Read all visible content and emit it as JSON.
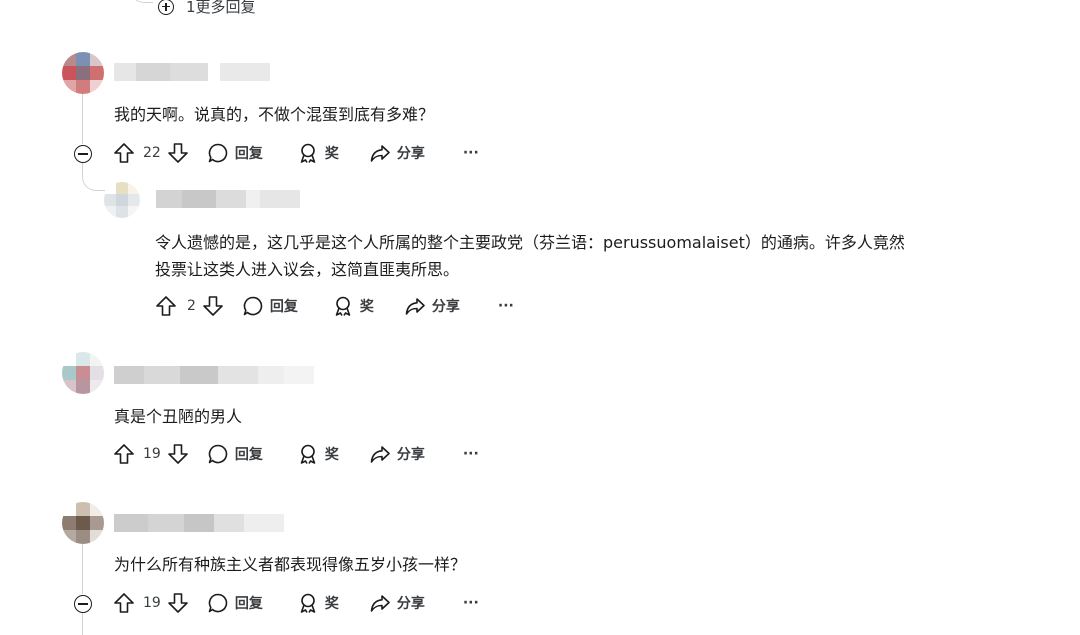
{
  "top_more_replies": "1更多回复",
  "labels": {
    "reply": "回复",
    "award": "奖",
    "share": "分享",
    "more": "···"
  },
  "comments": [
    {
      "text": "我的天啊。说真的，不做个混蛋到底有多难？",
      "votes": "22"
    },
    {
      "text_line1": "令人遗憾的是，这几乎是这个人所属的整个主要政党（芬兰语：perussuomalaiset）的通病。许多人竟然",
      "text_line2": "投票让这类人进入议会，这简直匪夷所思。",
      "votes": "2"
    },
    {
      "text": "真是个丑陋的男人",
      "votes": "19"
    },
    {
      "text": "为什么所有种族主义者都表现得像五岁小孩一样？",
      "votes": "19"
    }
  ],
  "colors": {
    "thread_line": "#d0d4d8",
    "text": "#1c1c1c",
    "action_text": "#3a3d40"
  }
}
